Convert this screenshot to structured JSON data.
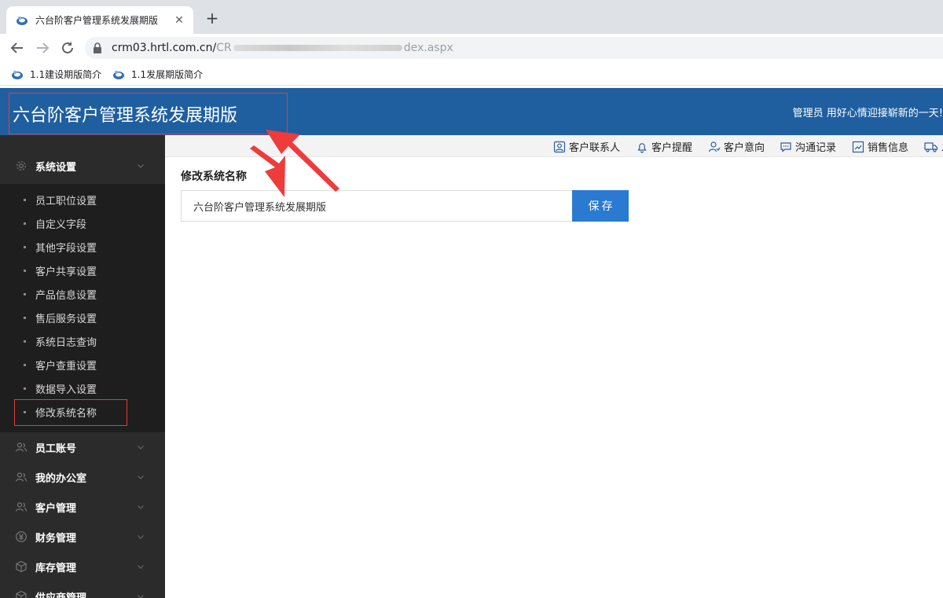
{
  "browser": {
    "tab_title": "六台阶客户管理系统发展期版",
    "close_glyph": "✕",
    "newtab_glyph": "+",
    "url_prefix": "crm03.hrtl.com.cn/",
    "url_faded": "CR",
    "url_suffix": "dex.aspx",
    "bookmarks": [
      {
        "label": "1.1建设期版简介"
      },
      {
        "label": "1.1发展期版简介"
      }
    ]
  },
  "header": {
    "title": "六台阶客户管理系统发展期版",
    "welcome": "管理员 用好心情迎接崭新的一天!",
    "color": "#1f5fa0"
  },
  "quick_nav": [
    {
      "label": "客户联系人",
      "icon": "contact-icon"
    },
    {
      "label": "客户提醒",
      "icon": "bell-icon"
    },
    {
      "label": "客户意向",
      "icon": "user-intent-icon"
    },
    {
      "label": "沟通记录",
      "icon": "chat-icon"
    },
    {
      "label": "销售信息",
      "icon": "chart-icon"
    },
    {
      "label": "发",
      "icon": "truck-icon"
    }
  ],
  "sidebar": {
    "groups": [
      {
        "label": "系统设置",
        "icon": "gear-icon",
        "expanded": true
      },
      {
        "label": "员工账号",
        "icon": "users-icon"
      },
      {
        "label": "我的办公室",
        "icon": "users-icon"
      },
      {
        "label": "客户管理",
        "icon": "users-icon"
      },
      {
        "label": "财务管理",
        "icon": "yen-icon"
      },
      {
        "label": "库存管理",
        "icon": "box-icon"
      },
      {
        "label": "供应商管理",
        "icon": "box-icon"
      }
    ],
    "items": [
      {
        "label": "员工职位设置"
      },
      {
        "label": "自定义字段"
      },
      {
        "label": "其他字段设置"
      },
      {
        "label": "客户共享设置"
      },
      {
        "label": "产品信息设置"
      },
      {
        "label": "售后服务设置"
      },
      {
        "label": "系统日志查询"
      },
      {
        "label": "客户查重设置"
      },
      {
        "label": "数据导入设置"
      },
      {
        "label": "修改系统名称",
        "active": true
      }
    ]
  },
  "form": {
    "label": "修改系统名称",
    "value": "六台阶客户管理系统发展期版",
    "save_label": "保存",
    "button_color": "#2a7ad2"
  },
  "annotation_color": "#e33b3b"
}
